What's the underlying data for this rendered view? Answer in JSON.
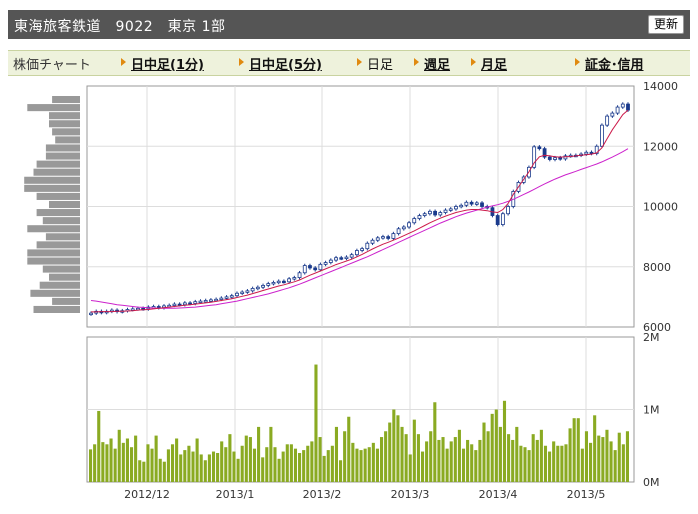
{
  "header": {
    "title": "東海旅客鉄道　9022　東京 1部",
    "refresh_label": "更新"
  },
  "tabs": {
    "label": "株価チャート",
    "items": [
      {
        "label": "日中足(1分)",
        "current": false
      },
      {
        "label": "日中足(5分)",
        "current": false
      },
      {
        "label": "日足",
        "current": true
      },
      {
        "label": "週足",
        "current": false
      },
      {
        "label": "月足",
        "current": false
      },
      {
        "label": "証金･信用",
        "current": false
      }
    ]
  },
  "colors": {
    "up": "#1a3a8c",
    "down": "#1a3a8c",
    "ma_short": "#cc1a4a",
    "ma_long": "#cc22cc",
    "volume": "#8aaa22",
    "profile": "#999999",
    "grid": "#dddddd",
    "axis": "#666666"
  },
  "chart_data": [
    {
      "type": "candlestick",
      "x_tick_labels": [
        "2012/12",
        "2013/1",
        "2013/2",
        "2013/3",
        "2013/4",
        "2013/5"
      ],
      "y_tick_labels": [
        "14000",
        "12000",
        "10000",
        "8000",
        "6000"
      ],
      "ylim": [
        6000,
        14000
      ],
      "grid": true,
      "close": [
        6460,
        6520,
        6480,
        6520,
        6560,
        6510,
        6540,
        6580,
        6600,
        6620,
        6600,
        6660,
        6680,
        6640,
        6700,
        6720,
        6760,
        6740,
        6800,
        6780,
        6840,
        6860,
        6880,
        6900,
        6920,
        6960,
        7000,
        7040,
        7120,
        7160,
        7200,
        7280,
        7320,
        7380,
        7440,
        7480,
        7520,
        7500,
        7600,
        7640,
        7800,
        8040,
        7960,
        7900,
        8080,
        8140,
        8220,
        8300,
        8280,
        8320,
        8400,
        8540,
        8600,
        8780,
        8880,
        8960,
        9000,
        8940,
        9100,
        9260,
        9320,
        9460,
        9600,
        9700,
        9760,
        9840,
        9720,
        9800,
        9880,
        9920,
        10000,
        10040,
        10140,
        10080,
        10120,
        10000,
        9960,
        9700,
        9400,
        9760,
        10000,
        10500,
        10800,
        10980,
        11300,
        11980,
        11920,
        11640,
        11560,
        11620,
        11580,
        11680,
        11700,
        11700,
        11740,
        11800,
        11760,
        12000,
        12700,
        13000,
        13100,
        13300,
        13400,
        13200
      ],
      "ma_short": [
        6500,
        6500,
        6510,
        6510,
        6510,
        6520,
        6520,
        6530,
        6540,
        6560,
        6570,
        6580,
        6600,
        6620,
        6640,
        6660,
        6680,
        6700,
        6720,
        6740,
        6760,
        6780,
        6800,
        6820,
        6850,
        6880,
        6910,
        6940,
        6980,
        7020,
        7060,
        7110,
        7160,
        7210,
        7260,
        7310,
        7360,
        7400,
        7450,
        7500,
        7560,
        7640,
        7720,
        7790,
        7860,
        7930,
        8000,
        8070,
        8130,
        8190,
        8250,
        8330,
        8410,
        8500,
        8590,
        8670,
        8750,
        8810,
        8880,
        8950,
        9030,
        9110,
        9190,
        9280,
        9370,
        9460,
        9540,
        9610,
        9680,
        9740,
        9800,
        9840,
        9880,
        9900,
        9900,
        9880,
        9860,
        9820,
        9800,
        9900,
        10100,
        10400,
        10650,
        10900,
        11150,
        11450,
        11650,
        11700,
        11680,
        11650,
        11640,
        11650,
        11660,
        11680,
        11700,
        11720,
        11740,
        11780,
        11950,
        12250,
        12550,
        12800,
        13050,
        13200
      ],
      "ma_long": [
        6880,
        6860,
        6830,
        6800,
        6770,
        6740,
        6720,
        6700,
        6680,
        6660,
        6650,
        6640,
        6630,
        6620,
        6620,
        6620,
        6620,
        6630,
        6640,
        6650,
        6660,
        6680,
        6700,
        6720,
        6740,
        6770,
        6800,
        6830,
        6860,
        6900,
        6940,
        6980,
        7020,
        7060,
        7100,
        7150,
        7200,
        7250,
        7300,
        7360,
        7420,
        7490,
        7560,
        7630,
        7700,
        7770,
        7840,
        7910,
        7980,
        8050,
        8120,
        8190,
        8260,
        8330,
        8410,
        8490,
        8570,
        8650,
        8730,
        8810,
        8890,
        8970,
        9050,
        9130,
        9210,
        9290,
        9370,
        9450,
        9520,
        9590,
        9660,
        9720,
        9780,
        9830,
        9880,
        9930,
        9980,
        10020,
        10060,
        10110,
        10170,
        10240,
        10320,
        10400,
        10480,
        10570,
        10660,
        10750,
        10830,
        10910,
        10980,
        11050,
        11110,
        11170,
        11230,
        11290,
        11350,
        11410,
        11480,
        11560,
        11640,
        11730,
        11820,
        11920
      ]
    },
    {
      "type": "bar",
      "name": "volume",
      "y_tick_labels": [
        "2M",
        "1M",
        "0M"
      ],
      "ylim": [
        0,
        2000000
      ],
      "values": [
        450000,
        520000,
        980000,
        550000,
        520000,
        600000,
        460000,
        720000,
        540000,
        600000,
        480000,
        640000,
        300000,
        280000,
        520000,
        460000,
        640000,
        320000,
        280000,
        450000,
        520000,
        600000,
        380000,
        440000,
        500000,
        420000,
        600000,
        380000,
        300000,
        380000,
        420000,
        400000,
        560000,
        480000,
        660000,
        420000,
        320000,
        500000,
        640000,
        620000,
        460000,
        760000,
        340000,
        480000,
        760000,
        480000,
        320000,
        420000,
        520000,
        520000,
        460000,
        400000,
        440000,
        500000,
        560000,
        1620000,
        620000,
        360000,
        440000,
        500000,
        760000,
        300000,
        700000,
        900000,
        540000,
        460000,
        440000,
        460000,
        480000,
        540000,
        460000,
        620000,
        700000,
        820000,
        1000000,
        920000,
        760000,
        660000,
        380000,
        860000,
        660000,
        420000,
        560000,
        700000,
        1100000,
        580000,
        620000,
        460000,
        560000,
        620000,
        720000,
        460000,
        580000,
        520000,
        440000,
        580000,
        820000,
        700000,
        940000,
        1000000,
        760000,
        1120000,
        660000,
        580000,
        760000,
        500000,
        480000,
        440000,
        660000,
        580000,
        720000,
        500000,
        420000,
        560000,
        500000,
        500000,
        520000,
        740000,
        880000,
        880000,
        460000,
        700000,
        540000,
        920000,
        640000,
        620000,
        720000,
        560000,
        440000,
        680000,
        520000,
        700000
      ]
    },
    {
      "type": "bar",
      "name": "price-volume-profile",
      "values": [
        9,
        17,
        10,
        10,
        9,
        8,
        11,
        11,
        14,
        15,
        18,
        18,
        14,
        10,
        14,
        12,
        17,
        11,
        14,
        17,
        17,
        12,
        10,
        13,
        16,
        9,
        15
      ]
    }
  ]
}
